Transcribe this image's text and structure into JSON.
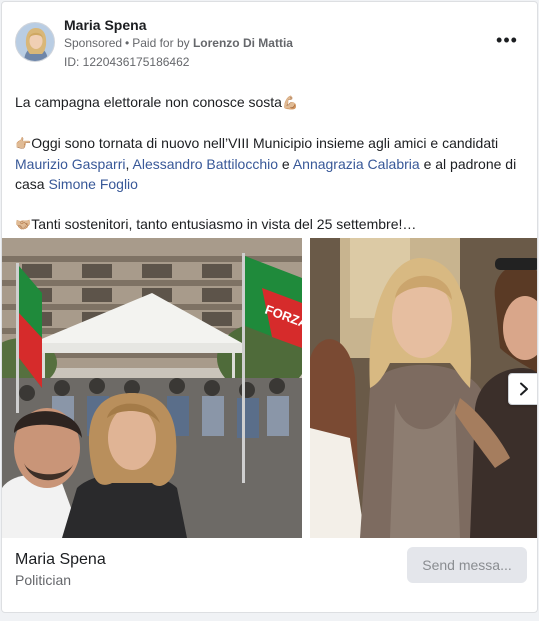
{
  "post": {
    "author": "Maria Spena",
    "sponsored": "Sponsored",
    "paid_for_prefix": "Paid for by",
    "paid_for_name": "Lorenzo Di Mattia",
    "ad_id": "ID: 1220436175186462",
    "more_icon": "more-horizontal-icon",
    "more_glyph": "•••"
  },
  "body": {
    "line1_text": "La campagna elettorale non conosce sosta",
    "line1_emoji": "💪🏼",
    "line2_emoji": "👉🏼",
    "line2_text_a": "Oggi sono tornata di nuovo nell’VIII Municipio insieme agli amici e candidati ",
    "link_1": "Maurizio Gasparri",
    "sep_comma": ", ",
    "link_2": "Alessandro Battilocchio",
    "sep_e": " e ",
    "link_3": "Annagrazia Calabria",
    "line2_text_b": " e al padrone di casa ",
    "link_4": "Simone Foglio",
    "line3_emoji": "🤝🏼",
    "line3_text": "Tanti sostenitori, tanto entusiasmo in vista del 25 settembre!…"
  },
  "carousel": {
    "slide1_flag_text": "FORZA",
    "next_icon": "chevron-right-icon"
  },
  "footer": {
    "name": "Maria Spena",
    "subtitle": "Politician",
    "send_button": "Send messa..."
  },
  "colors": {
    "link": "#385898",
    "secondary_text": "#65676b",
    "button_bg": "#e4e6eb",
    "flag_green": "#1f8a3b",
    "flag_red": "#d62b2b"
  }
}
